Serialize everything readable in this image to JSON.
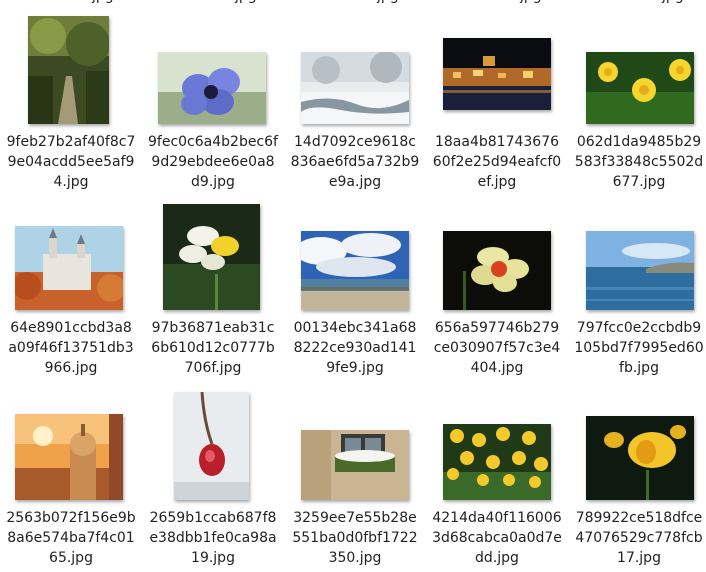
{
  "window": {
    "title": ""
  },
  "prev_row_tail": [
    "jpg",
    "jpg",
    "jpg",
    "jpg",
    "jpg"
  ],
  "items": [
    {
      "file": "9feb27b2af40f8c79e04acdd5ee5af94.jpg",
      "icon": "image-thumbnail-icon",
      "subject": "forest-path"
    },
    {
      "file": "9fec0c6a4b2bec6f9d29ebdee6e0a8d9.jpg",
      "icon": "image-thumbnail-icon",
      "subject": "blue-anemone"
    },
    {
      "file": "14d7092ce9618c836ae6fd5a732b9e9a.jpg",
      "icon": "image-thumbnail-icon",
      "subject": "snowy-stream"
    },
    {
      "file": "18aa4b8174367660f2e25d94eafcf0ef.jpg",
      "icon": "image-thumbnail-icon",
      "subject": "night-harbor"
    },
    {
      "file": "062d1da9485b29583f33848c5502d677.jpg",
      "icon": "image-thumbnail-icon",
      "subject": "yellow-daffodils"
    },
    {
      "file": "64e8901ccbd3a8a09f46f13751db3966.jpg",
      "icon": "image-thumbnail-icon",
      "subject": "castle-autumn"
    },
    {
      "file": "97b36871eab31c6b610d12c0777b706f.jpg",
      "icon": "image-thumbnail-icon",
      "subject": "white-daffodil"
    },
    {
      "file": "00134ebc341a688222ce930ad1419fe9.jpg",
      "icon": "image-thumbnail-icon",
      "subject": "cloudy-beach"
    },
    {
      "file": "656a597746b279ce030907f57c3e4404.jpg",
      "icon": "image-thumbnail-icon",
      "subject": "daffodil-red-cup"
    },
    {
      "file": "797fcc0e2ccbdb9105bd7f7995ed60fb.jpg",
      "icon": "image-thumbnail-icon",
      "subject": "sea-coast"
    },
    {
      "file": "2563b072f156e9b8a6e574ba7f4c0165.jpg",
      "icon": "image-thumbnail-icon",
      "subject": "sunset-dome"
    },
    {
      "file": "2659b1ccab687f8e38dbb1fe0ca98a19.jpg",
      "icon": "image-thumbnail-icon",
      "subject": "frozen-rosehip"
    },
    {
      "file": "3259ee7e55b28e551ba0d0fbf1722350.jpg",
      "icon": "image-thumbnail-icon",
      "subject": "window-flowerbox"
    },
    {
      "file": "4214da40f1160063d68cabca0a0d7edd.jpg",
      "icon": "image-thumbnail-icon",
      "subject": "daffodil-field"
    },
    {
      "file": "789922ce518dfce47076529c778fcb17.jpg",
      "icon": "image-thumbnail-icon",
      "subject": "daffodil-closeup"
    }
  ],
  "colors": {
    "text": "#222222",
    "background": "#ffffff"
  }
}
